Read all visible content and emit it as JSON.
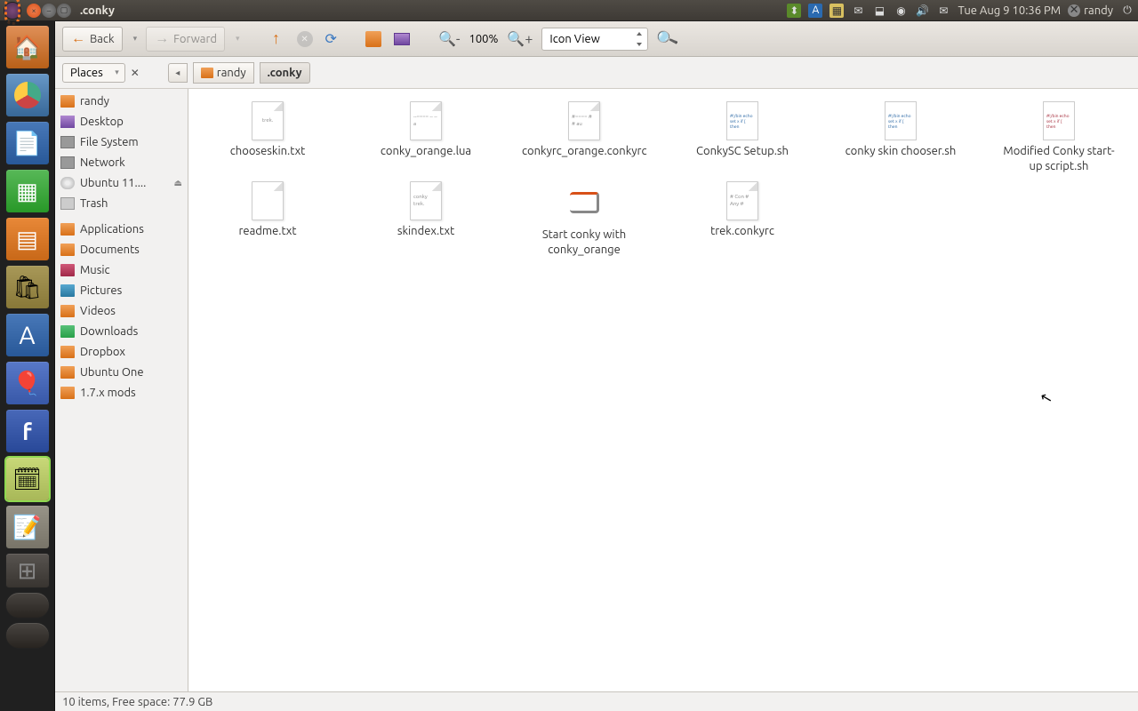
{
  "panel": {
    "window_title": ".conky",
    "datetime": "Tue Aug  9 10:36 PM",
    "username": "randy"
  },
  "toolbar": {
    "back": "Back",
    "forward": "Forward",
    "zoom": "100%",
    "view_mode": "Icon View"
  },
  "pathbar": {
    "places_label": "Places",
    "segments": [
      "randy",
      ".conky"
    ]
  },
  "sidebar": {
    "items": [
      {
        "label": "randy",
        "icon": "home"
      },
      {
        "label": "Desktop",
        "icon": "desk"
      },
      {
        "label": "File System",
        "icon": "fs"
      },
      {
        "label": "Network",
        "icon": "net"
      },
      {
        "label": "Ubuntu 11....",
        "icon": "disc",
        "eject": true
      },
      {
        "label": "Trash",
        "icon": "trash"
      },
      {
        "label": "Applications",
        "icon": "folder",
        "sep_before": true
      },
      {
        "label": "Documents",
        "icon": "folder"
      },
      {
        "label": "Music",
        "icon": "mus"
      },
      {
        "label": "Pictures",
        "icon": "pic"
      },
      {
        "label": "Videos",
        "icon": "folder"
      },
      {
        "label": "Downloads",
        "icon": "dl"
      },
      {
        "label": "Dropbox",
        "icon": "folder"
      },
      {
        "label": "Ubuntu One",
        "icon": "folder"
      },
      {
        "label": "1.7.x mods",
        "icon": "folder"
      }
    ]
  },
  "files": [
    {
      "name": "chooseskin.txt",
      "type": "txt",
      "preview": "trek."
    },
    {
      "name": "conky_orange.lua",
      "type": "txt",
      "preview": "--====\n--\n--    a"
    },
    {
      "name": "conkyrc_orange.conkyrc",
      "type": "txt",
      "preview": "#====\n#\n#   au"
    },
    {
      "name": "ConkySC Setup.sh",
      "type": "script"
    },
    {
      "name": "conky skin chooser.sh",
      "type": "script"
    },
    {
      "name": "Modified Conky start-up script.sh",
      "type": "script-r"
    },
    {
      "name": "readme.txt",
      "type": "txt",
      "preview": ""
    },
    {
      "name": "skindex.txt",
      "type": "txt",
      "preview": "conky\ntrek."
    },
    {
      "name": "Start conky with conky_orange",
      "type": "link"
    },
    {
      "name": "trek.conkyrc",
      "type": "txt",
      "preview": "# Con\n# Any\n#"
    }
  ],
  "statusbar": {
    "text": "10 items, Free space: 77.9 GB"
  }
}
